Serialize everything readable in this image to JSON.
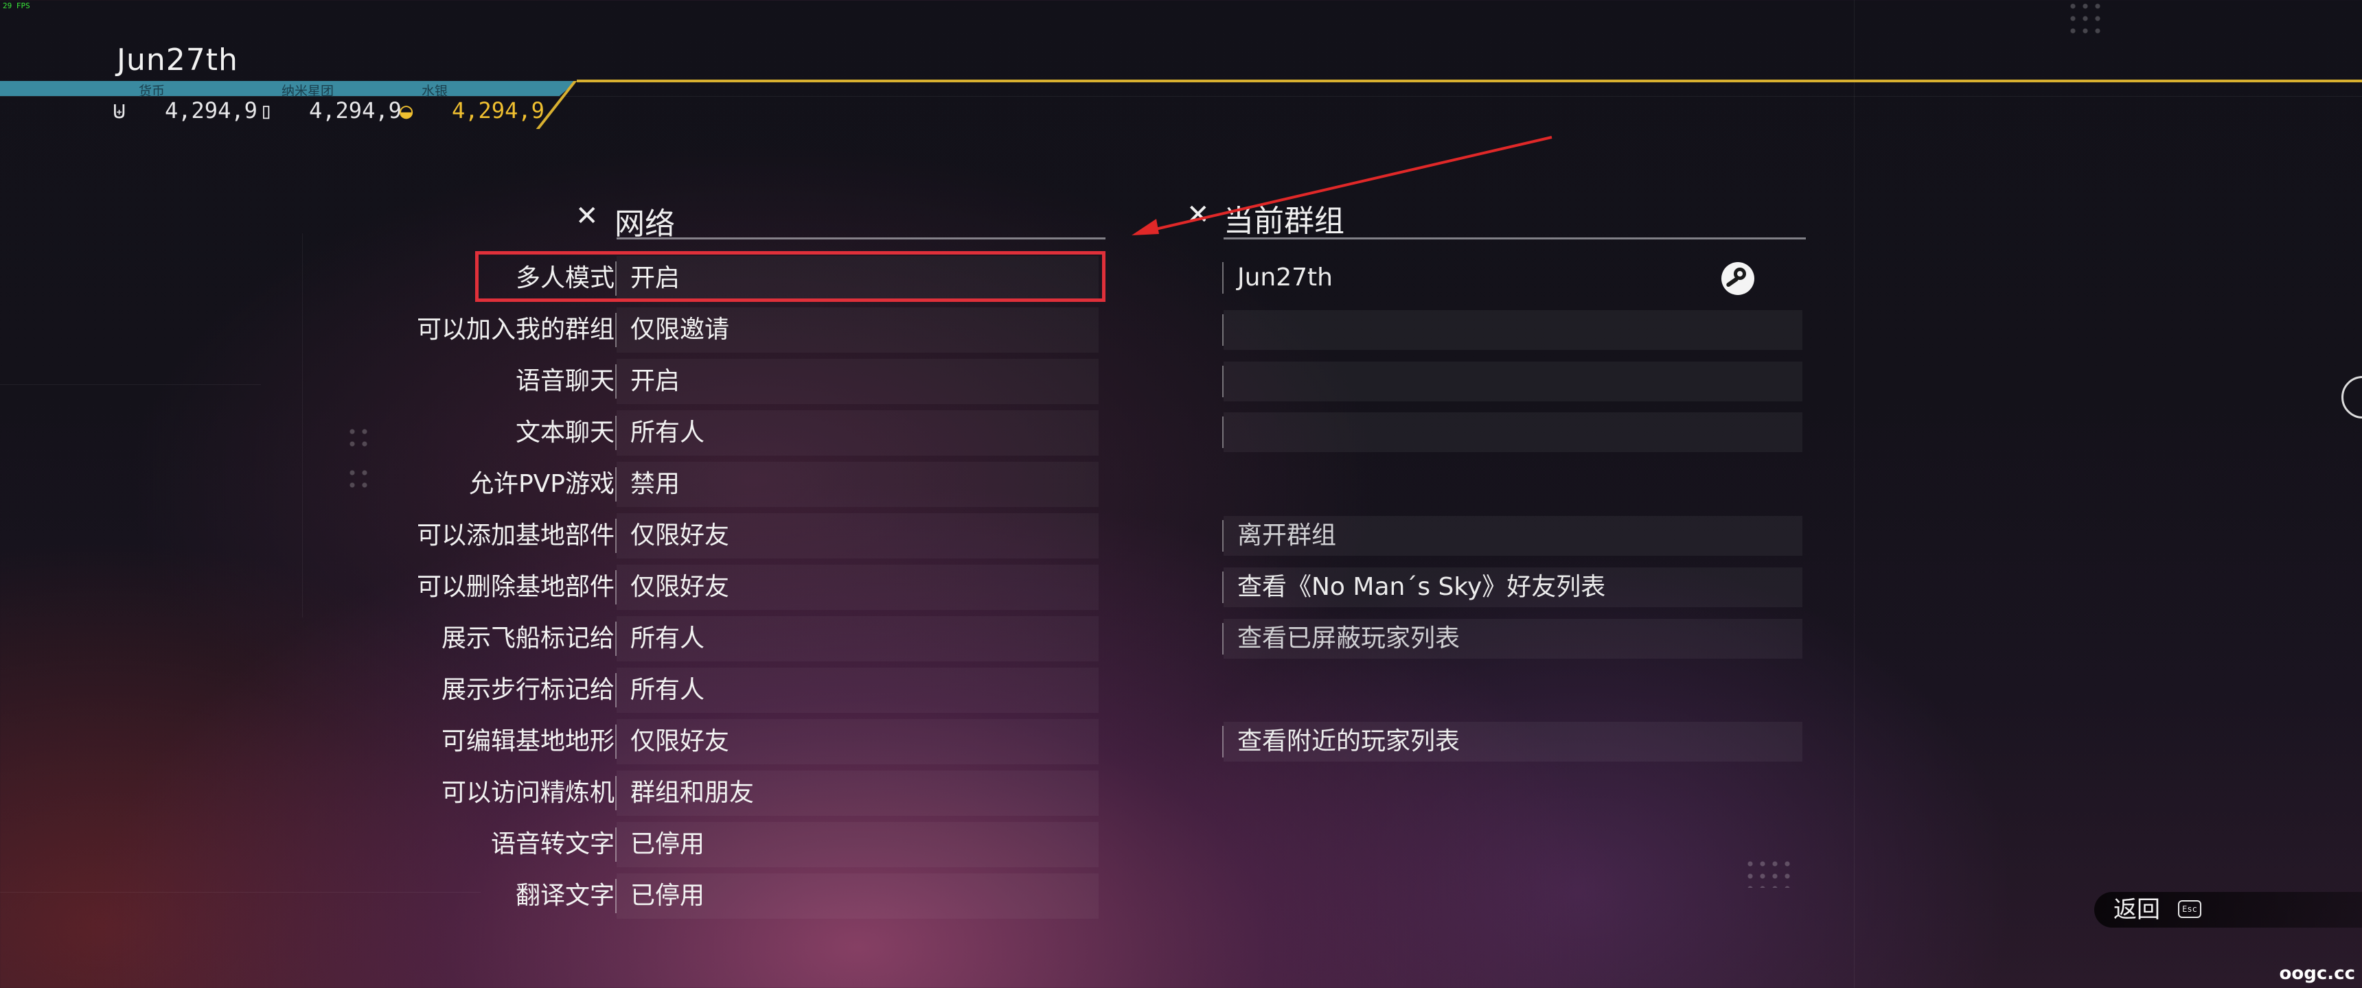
{
  "fps": "29 FPS",
  "header": {
    "username": "Jun27th",
    "currencies": [
      {
        "label": "货币",
        "value": "4,294,9",
        "icon": "units-icon"
      },
      {
        "label": "纳米星团",
        "value": "4,294,9",
        "icon": "nanite-icon"
      },
      {
        "label": "水银",
        "value": "4,294,9",
        "icon": "quicksilver-icon"
      }
    ]
  },
  "network": {
    "title": "网络",
    "icon": "tools-icon",
    "settings": [
      {
        "label": "多人模式",
        "value": "开启"
      },
      {
        "label": "可以加入我的群组",
        "value": "仅限邀请"
      },
      {
        "label": "语音聊天",
        "value": "开启"
      },
      {
        "label": "文本聊天",
        "value": "所有人"
      },
      {
        "label": "允许PVP游戏",
        "value": "禁用"
      },
      {
        "label": "可以添加基地部件",
        "value": "仅限好友"
      },
      {
        "label": "可以删除基地部件",
        "value": "仅限好友"
      },
      {
        "label": "展示飞船标记给",
        "value": "所有人"
      },
      {
        "label": "展示步行标记给",
        "value": "所有人"
      },
      {
        "label": "可编辑基地地形",
        "value": "仅限好友"
      },
      {
        "label": "可以访问精炼机",
        "value": "群组和朋友"
      },
      {
        "label": "语音转文字",
        "value": "已停用"
      },
      {
        "label": "翻译文字",
        "value": "已停用"
      }
    ]
  },
  "group": {
    "title": "当前群组",
    "icon": "tools-icon",
    "members": [
      "Jun27th",
      "",
      "",
      ""
    ],
    "member_icon": "steam-icon",
    "actions": [
      "离开群组",
      "查看《No Man´s Sky》好友列表",
      "查看已屏蔽玩家列表",
      "查看附近的玩家列表"
    ]
  },
  "footer": {
    "back_label": "返回",
    "back_key": "Esc"
  },
  "watermark": "oogc.cc",
  "colors": {
    "accent_gold": "#d8b030",
    "header_teal": "#3a8aa0",
    "highlight_red": "#e0303a"
  }
}
